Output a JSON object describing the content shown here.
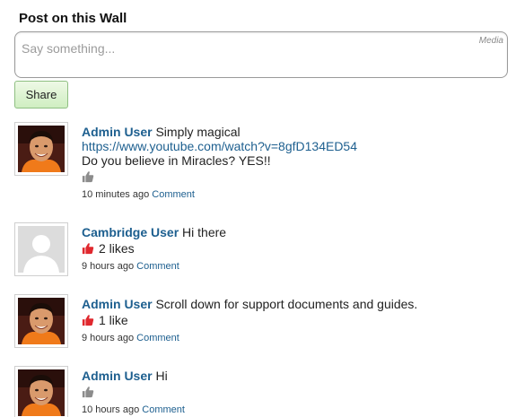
{
  "wall": {
    "title": "Post on this Wall",
    "placeholder": "Say something...",
    "media_label": "Media",
    "share_label": "Share"
  },
  "posts": [
    {
      "author": "Admin User",
      "text": " Simply magical",
      "url": "https://www.youtube.com/watch?v=8gfD134ED54",
      "text2": "Do you believe in Miracles? YES!!",
      "liked": false,
      "likes": "",
      "time": "10 minutes ago",
      "comment_label": "Comment",
      "avatar": "admin-photo"
    },
    {
      "author": "Cambridge User",
      "text": " Hi there",
      "liked": true,
      "likes": "2 likes",
      "time": "9 hours ago",
      "comment_label": "Comment",
      "avatar": "default-silhouette"
    },
    {
      "author": "Admin User",
      "text": " Scroll down for support documents and guides.",
      "liked": true,
      "likes": "1 like",
      "time": "9 hours ago",
      "comment_label": "Comment",
      "avatar": "admin-photo"
    },
    {
      "author": "Admin User",
      "text": " Hi",
      "liked": false,
      "likes": "",
      "time": "10 hours ago",
      "comment_label": "Comment",
      "avatar": "admin-photo"
    }
  ],
  "icons": {
    "like_active_color": "#e0282e",
    "like_inactive_color": "#8c8c8c",
    "link_color": "#1d5f8f",
    "share_button_color": "#d9f3cc"
  }
}
